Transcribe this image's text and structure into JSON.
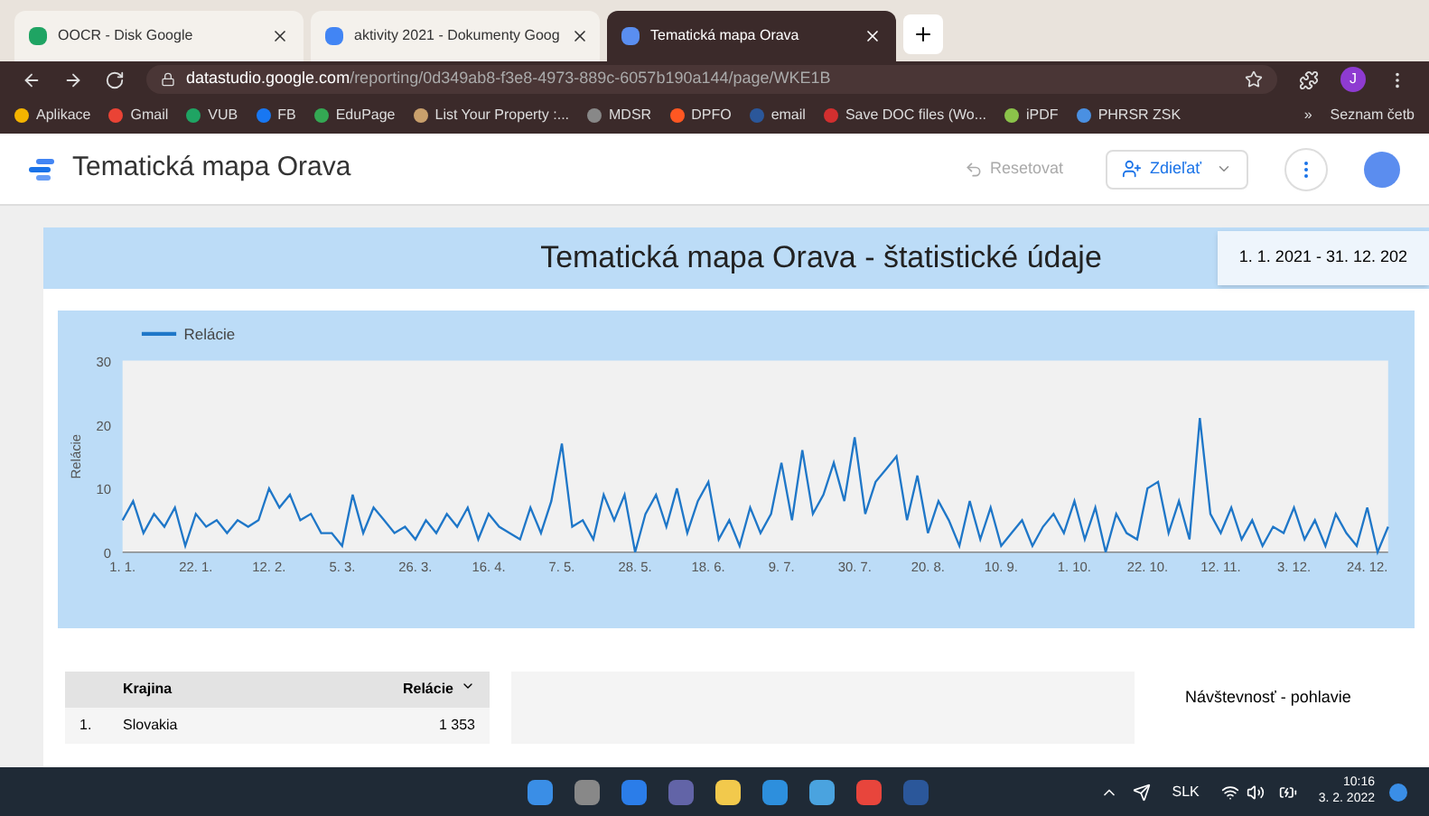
{
  "browser": {
    "tabs": [
      {
        "label": "OOCR - Disk Google",
        "selected": false
      },
      {
        "label": "aktivity 2021 - Dokumenty Goog",
        "selected": false
      },
      {
        "label": "Tematická mapa Orava",
        "selected": true
      }
    ],
    "url_host": "datastudio.google.com",
    "url_path": "/reporting/0d349ab8-f3e8-4973-889c-6057b190a144/page/WKE1B",
    "profile": "J",
    "bookmarks": [
      {
        "label": "Aplikace"
      },
      {
        "label": "Gmail"
      },
      {
        "label": "VUB"
      },
      {
        "label": "FB"
      },
      {
        "label": "EduPage"
      },
      {
        "label": "List Your Property :..."
      },
      {
        "label": "MDSR"
      },
      {
        "label": "DPFO"
      },
      {
        "label": "email"
      },
      {
        "label": "Save DOC files (Wo..."
      },
      {
        "label": "iPDF"
      },
      {
        "label": "PHRSR ZSK"
      }
    ],
    "overflow": "»",
    "reading_list": "Seznam četb"
  },
  "app": {
    "title": "Tematická mapa Orava",
    "reset": "Resetovat",
    "share": "Zdieľať"
  },
  "report": {
    "title": "Tematická mapa Orava - štatistické údaje",
    "date_range": "1. 1. 2021 - 31. 12. 202",
    "chart": {
      "chart_data": {
        "type": "line",
        "ylabel": "Relácie",
        "ylim": [
          0,
          30
        ],
        "yticks": [
          0,
          10,
          20,
          30
        ],
        "categories": [
          "1. 1.",
          null,
          null,
          null,
          null,
          null,
          null,
          "22. 1.",
          null,
          null,
          null,
          null,
          null,
          null,
          "12. 2.",
          null,
          null,
          null,
          null,
          null,
          null,
          "5. 3.",
          null,
          null,
          null,
          null,
          null,
          null,
          "26. 3.",
          null,
          null,
          null,
          null,
          null,
          null,
          "16. 4.",
          null,
          null,
          null,
          null,
          null,
          null,
          "7. 5.",
          null,
          null,
          null,
          null,
          null,
          null,
          "28. 5.",
          null,
          null,
          null,
          null,
          null,
          null,
          "18. 6.",
          null,
          null,
          null,
          null,
          null,
          null,
          "9. 7.",
          null,
          null,
          null,
          null,
          null,
          null,
          "30. 7.",
          null,
          null,
          null,
          null,
          null,
          null,
          "20. 8.",
          null,
          null,
          null,
          null,
          null,
          null,
          "10. 9.",
          null,
          null,
          null,
          null,
          null,
          null,
          "1. 10.",
          null,
          null,
          null,
          null,
          null,
          null,
          "22. 10.",
          null,
          null,
          null,
          null,
          null,
          null,
          "12. 11.",
          null,
          null,
          null,
          null,
          null,
          null,
          "3. 12.",
          null,
          null,
          null,
          null,
          null,
          null,
          "24. 12.",
          null,
          null
        ],
        "series": [
          {
            "name": "Relácie",
            "color": "#1f77c8",
            "values": [
              5,
              8,
              3,
              6,
              4,
              7,
              1,
              6,
              4,
              5,
              3,
              5,
              4,
              5,
              10,
              7,
              9,
              5,
              6,
              3,
              3,
              1,
              9,
              3,
              7,
              5,
              3,
              4,
              2,
              5,
              3,
              6,
              4,
              7,
              2,
              6,
              4,
              3,
              2,
              7,
              3,
              8,
              17,
              4,
              5,
              2,
              9,
              5,
              9,
              0,
              6,
              9,
              4,
              10,
              3,
              8,
              11,
              2,
              5,
              1,
              7,
              3,
              6,
              14,
              5,
              16,
              6,
              9,
              14,
              8,
              18,
              6,
              11,
              13,
              15,
              5,
              12,
              3,
              8,
              5,
              1,
              8,
              2,
              7,
              1,
              3,
              5,
              1,
              4,
              6,
              3,
              8,
              2,
              7,
              0,
              6,
              3,
              2,
              10,
              11,
              3,
              8,
              2,
              21,
              6,
              3,
              7,
              2,
              5,
              1,
              4,
              3,
              7,
              2,
              5,
              1,
              6,
              3,
              1,
              7,
              0,
              4
            ]
          }
        ]
      }
    },
    "table": {
      "columns": [
        "Krajina",
        "Relácie"
      ],
      "rows": [
        {
          "index": "1.",
          "country": "Slovakia",
          "sessions": "1 353"
        }
      ]
    },
    "gender_title": "Návštevnosť - pohlavie"
  },
  "taskbar": {
    "language": "SLK",
    "time": "10:16",
    "date": "3. 2. 2022"
  }
}
